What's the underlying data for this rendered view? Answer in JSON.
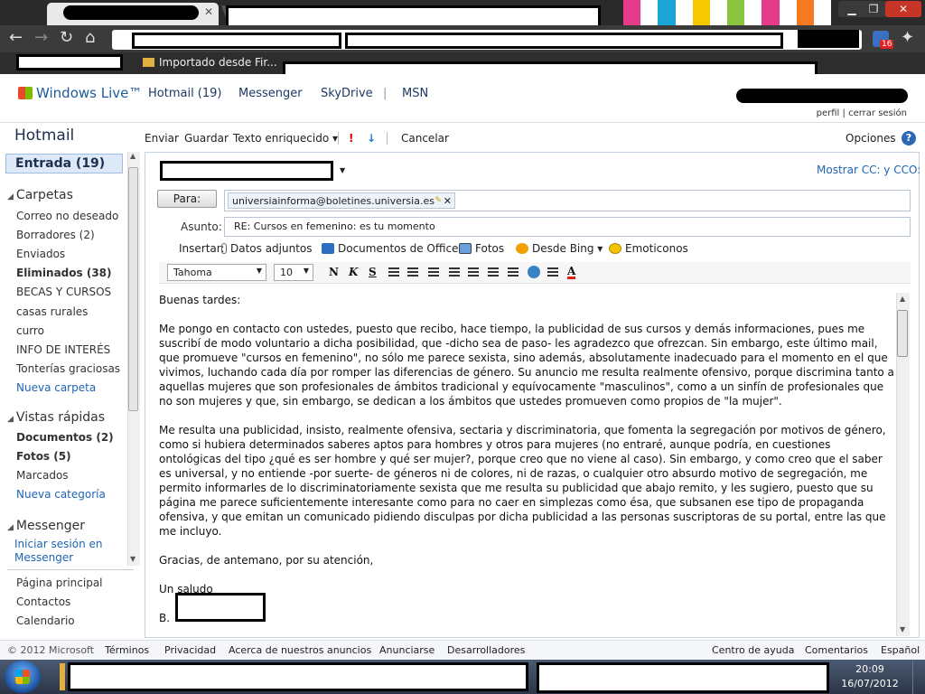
{
  "browser": {
    "bookmark_folder": "Importado desde Fir...",
    "extension_badge": "16"
  },
  "windows_live": {
    "logo": "Windows Live™",
    "nav": [
      "Hotmail (19)",
      "Messenger",
      "SkyDrive",
      "|",
      "MSN"
    ],
    "profile_link": "perfil",
    "profile_sep": "|",
    "signout_link": "cerrar sesión"
  },
  "sidebar": {
    "title": "Hotmail",
    "inbox": "Entrada (19)",
    "folders_head": "Carpetas",
    "folders": [
      {
        "label": "Correo no deseado",
        "style": ""
      },
      {
        "label": "Borradores (2)",
        "style": ""
      },
      {
        "label": "Enviados",
        "style": ""
      },
      {
        "label": "Eliminados (38)",
        "style": "bold"
      },
      {
        "label": "BECAS Y CURSOS",
        "style": ""
      },
      {
        "label": "casas rurales",
        "style": ""
      },
      {
        "label": "curro",
        "style": ""
      },
      {
        "label": "INFO DE INTERÉS",
        "style": ""
      },
      {
        "label": "Tonterías graciosas",
        "style": ""
      },
      {
        "label": "Nueva carpeta",
        "style": "link"
      }
    ],
    "quick_head": "Vistas rápidas",
    "quick": [
      {
        "label": "Documentos  (2)",
        "style": "bold"
      },
      {
        "label": "Fotos  (5)",
        "style": "bold"
      },
      {
        "label": "Marcados",
        "style": ""
      },
      {
        "label": "Nueva categoría",
        "style": "link"
      }
    ],
    "messenger_head": "Messenger",
    "messenger_link_1": "Iniciar sesión en",
    "messenger_link_2": "Messenger",
    "bottom": [
      "Página principal",
      "Contactos",
      "Calendario"
    ]
  },
  "compose_bar": {
    "send": "Enviar",
    "save": "Guardar",
    "rich_text": "Texto enriquecido ▾",
    "cancel": "Cancelar",
    "options": "Opciones",
    "help": "?"
  },
  "compose": {
    "show_cc": "Mostrar CC: y CCO:",
    "to_button": "Para:",
    "to_value": "universiainforma@boletines.universia.es",
    "subject_label": "Asunto:",
    "subject_value": "RE: Cursos en femenino: es tu momento",
    "insert_label": "Insertar:",
    "insert": [
      "Datos adjuntos",
      "Documentos de Office",
      "Fotos",
      "Desde Bing ▾",
      "Emoticonos"
    ],
    "font": "Tahoma",
    "size": "10",
    "bold": "N",
    "italic": "K",
    "underline": "S",
    "font_color": "A"
  },
  "body": {
    "greeting": "Buenas tardes:",
    "p1": "Me pongo en contacto con ustedes, puesto que recibo, hace tiempo, la publicidad de sus cursos y demás informaciones, pues me suscribí de modo voluntario a dicha posibilidad, que -dicho sea de paso- les agradezco que ofrezcan. Sin embargo, este último mail, que promueve \"cursos en femenino\", no sólo me parece sexista, sino además, absolutamente inadecuado para el momento en el que vivimos, luchando cada día por romper las diferencias de género. Su anuncio me resulta realmente ofensivo, porque discrimina tanto a aquellas mujeres que son profesionales de ámbitos tradicional y equívocamente \"masculinos\", como a un sinfín de profesionales que no son mujeres y que, sin embargo, se dedican a los ámbitos que ustedes promueven como propios de \"la mujer\".",
    "p2": "Me resulta una publicidad, insisto, realmente ofensiva, sectaria y discriminatoria, que fomenta la segregación por motivos de género, como si hubiera determinados saberes aptos para hombres y otros para mujeres (no entraré, aunque podría, en cuestiones ontológicas del tipo ¿qué es ser hombre y qué ser mujer?, porque creo que no viene al caso). Sin embargo, y como creo que el saber es universal, y no entiende -por suerte- de géneros ni de colores, ni de razas, o cualquier otro absurdo motivo de segregación, me permito informarles de lo discriminatoriamente sexista que me resulta su publicidad que abajo remito, y les sugiero, puesto que su página me parece suficientemente interesante como para no caer en simplezas como ésa, que subsanen ese tipo de propaganda ofensiva, y que emitan un comunicado pidiendo disculpas por dicha publicidad a las personas suscriptoras de su portal, entre las que me incluyo.",
    "p3": "Gracias, de antemano, por su atención,",
    "p4": "Un saludo",
    "sign": "B."
  },
  "footer": {
    "copyright": "© 2012 Microsoft",
    "links": [
      "Términos",
      "Privacidad",
      "Acerca de nuestros anuncios",
      "Anunciarse",
      "Desarrolladores"
    ],
    "right": [
      "Centro de ayuda",
      "Comentarios",
      "Español"
    ]
  },
  "taskbar": {
    "time": "20:09",
    "date": "16/07/2012"
  }
}
